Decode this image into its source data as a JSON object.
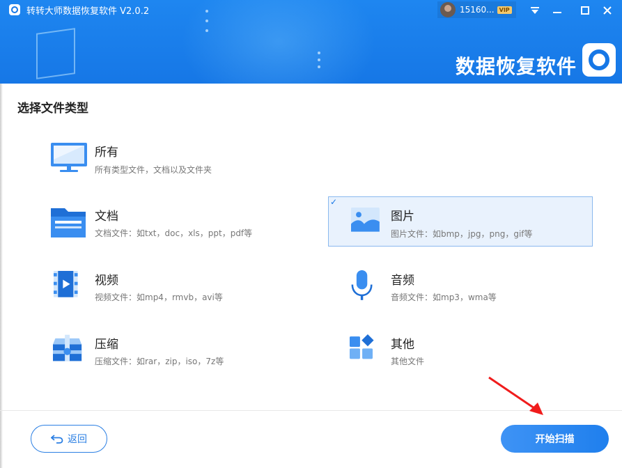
{
  "app": {
    "title": "转转大师数据恢复软件 V2.0.2",
    "brand_text": "数据恢复软件",
    "user_name": "15160...",
    "vip_badge": "VIP",
    "accent_color": "#1677e6"
  },
  "window_controls": {
    "menu_icon": "menu-triangle-icon",
    "minimize_icon": "minimize-icon",
    "maximize_icon": "maximize-icon",
    "close_icon": "close-icon"
  },
  "section_title": "选择文件类型",
  "types": [
    {
      "name": "所有",
      "desc": "所有类型文件，文档以及文件夹",
      "icon": "monitor-icon",
      "selected": false
    },
    {
      "name": "文档",
      "desc": "文档文件：如txt，doc，xls，ppt，pdf等",
      "icon": "folder-icon",
      "selected": false
    },
    {
      "name": "图片",
      "desc": "图片文件：如bmp，jpg，png，gif等",
      "icon": "image-icon",
      "selected": true
    },
    {
      "name": "视频",
      "desc": "视频文件：如mp4，rmvb，avi等",
      "icon": "video-icon",
      "selected": false
    },
    {
      "name": "音频",
      "desc": "音频文件：如mp3，wma等",
      "icon": "microphone-icon",
      "selected": false
    },
    {
      "name": "压缩",
      "desc": "压缩文件：如rar，zip，iso，7z等",
      "icon": "archive-icon",
      "selected": false
    },
    {
      "name": "其他",
      "desc": "其他文件",
      "icon": "apps-grid-icon",
      "selected": false
    }
  ],
  "buttons": {
    "back_label": "返回",
    "scan_label": "开始扫描"
  }
}
